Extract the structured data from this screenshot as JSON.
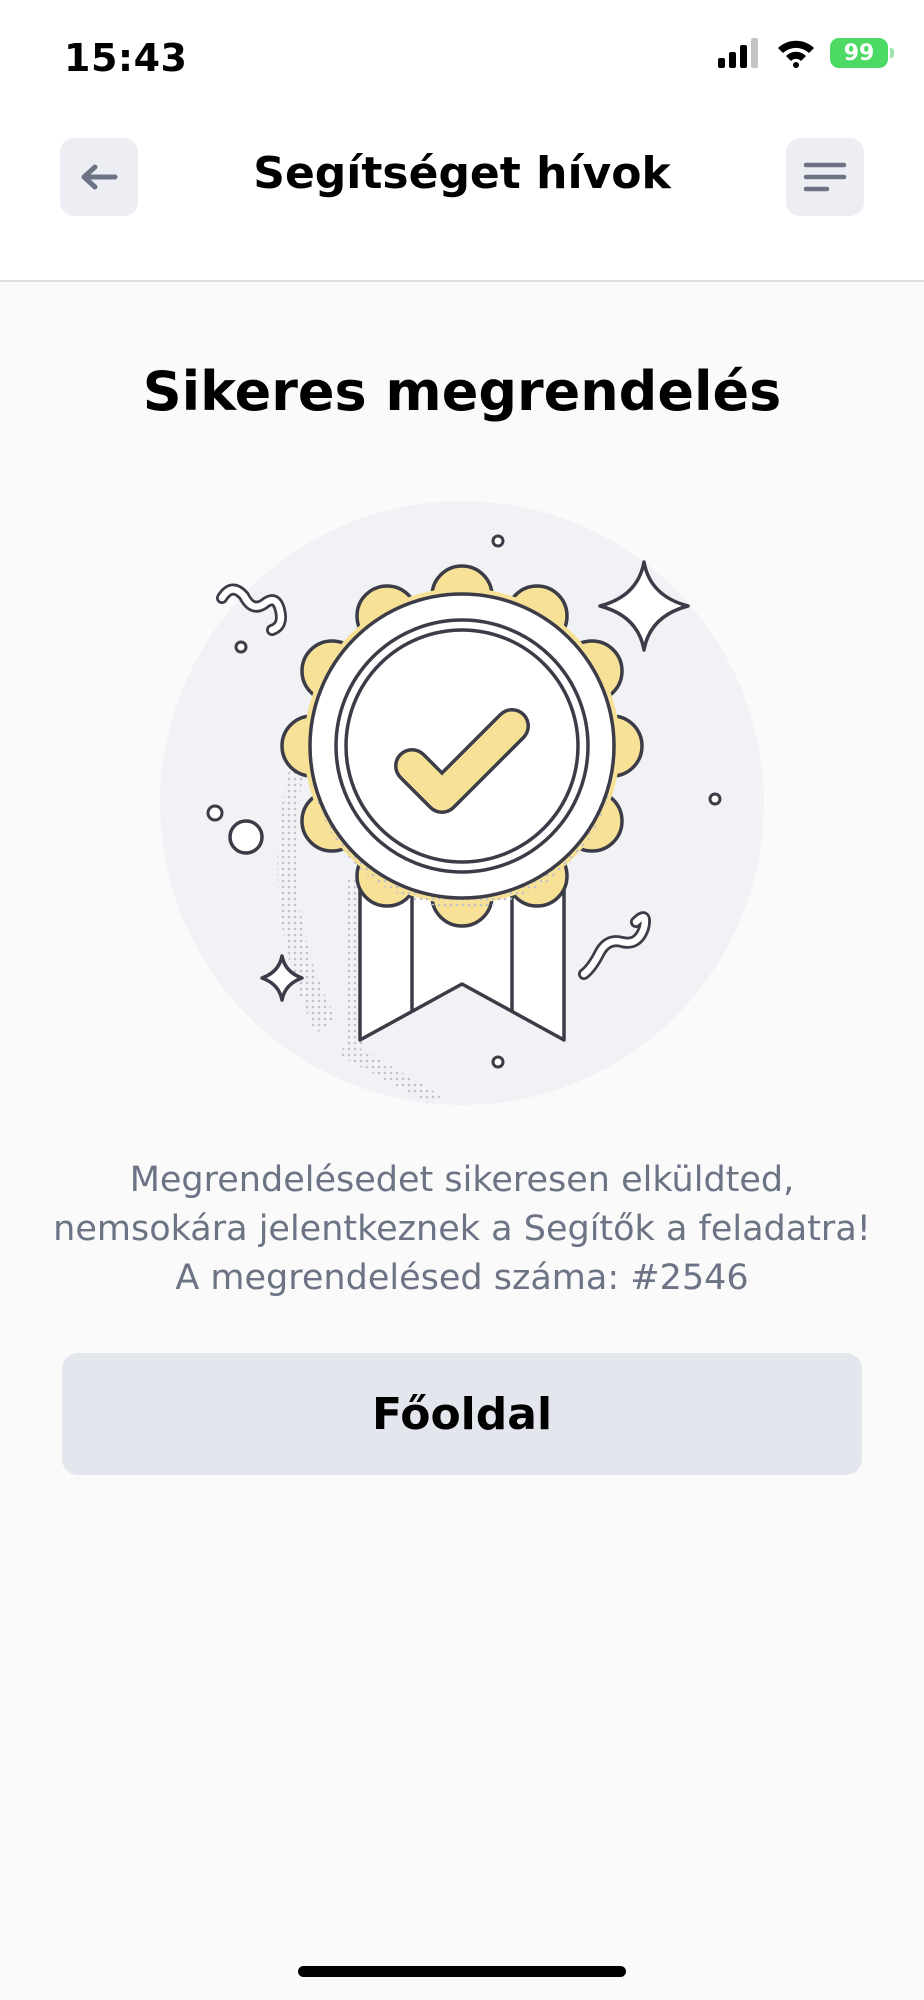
{
  "status_bar": {
    "time": "15:43",
    "battery_percent": "99",
    "icons": [
      "cellular-signal-icon",
      "wifi-icon",
      "battery-charging-icon"
    ]
  },
  "header": {
    "title": "Segítséget hívok",
    "back_icon": "arrow-left-icon",
    "menu_icon": "menu-icon"
  },
  "main": {
    "title": "Sikeres megrendelés",
    "illustration_icon": "award-badge-checkmark-icon",
    "message_lines": [
      "Megrendelésedet sikeresen elküldted,",
      "nemsokára jelentkeznek a Segítők a feladatra!",
      "A megrendelésed száma: #2546"
    ],
    "home_button_label": "Főoldal"
  },
  "colors": {
    "background": "#fafafa",
    "header_background": "#ffffff",
    "button_background": "#e3e6ed",
    "message_text": "#6b7384",
    "badge_gold": "#f7e197",
    "battery_green": "#4cd964"
  }
}
